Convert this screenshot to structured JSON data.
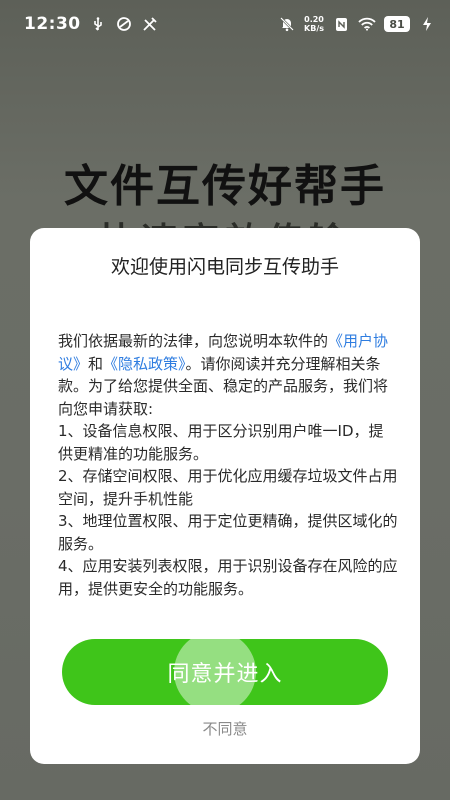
{
  "status_bar": {
    "time": "12:30",
    "net_speed_value": "0.20",
    "net_speed_unit": "KB/s",
    "battery": "81"
  },
  "background": {
    "headline": "文件互传好帮手",
    "subheadline": "快速高效传输"
  },
  "dialog": {
    "title": "欢迎使用闪电同步互传助手",
    "intro_before": "我们依据最新的法律，向您说明本软件的",
    "user_agreement_link": "《用户协议》",
    "and": "和",
    "privacy_policy_link": "《隐私政策》",
    "intro_after": "。请你阅读并充分理解相关条款。为了给您提供全面、稳定的产品服务，我们将向您申请获取:",
    "items": [
      "1、设备信息权限、用于区分识别用户唯一ID，提供更精准的功能服务。",
      "2、存储空间权限、用于优化应用缓存垃圾文件占用空间，提升手机性能",
      "3、地理位置权限、用于定位更精确，提供区域化的服务。",
      "4、应用安装列表权限，用于识别设备存在风险的应用，提供更安全的功能服务。"
    ],
    "agree_button": "同意并进入",
    "disagree_link": "不同意"
  },
  "colors": {
    "accent_green": "#3fc51a",
    "link_blue": "#2f7de0"
  }
}
